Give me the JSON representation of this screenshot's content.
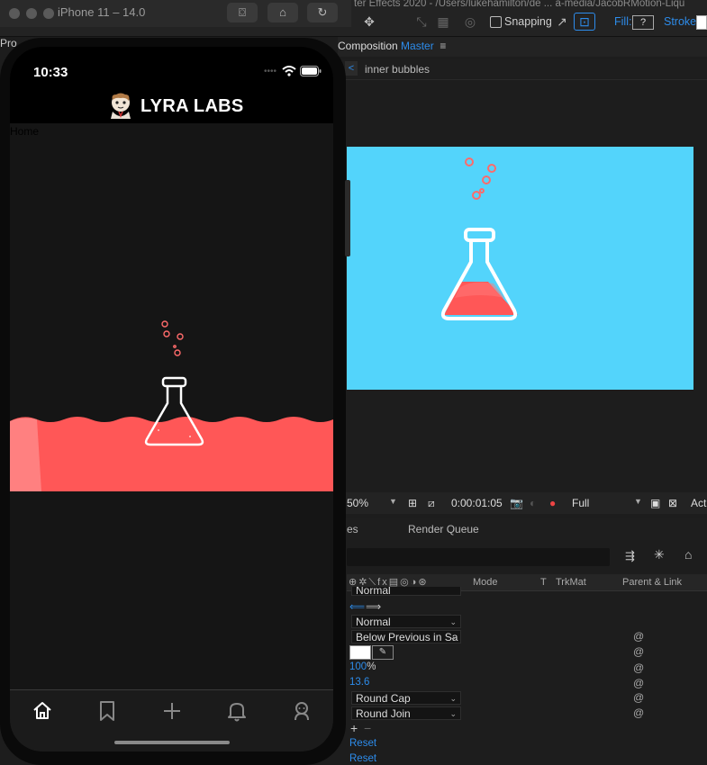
{
  "simulator": {
    "title": "iPhone 11 – 14.0"
  },
  "app": {
    "status_time": "10:33",
    "brand": "LYRA LABS",
    "page_label": "Home",
    "tabs": [
      "home-icon",
      "bookmark-icon",
      "plus-icon",
      "bell-icon",
      "profile-icon"
    ]
  },
  "ae": {
    "window_title": "ter Effects 2020 - /Users/lukehamilton/de ... a-media/JacobRMotion-Liqu",
    "snapping_label": "Snapping",
    "fill_label": "Fill:",
    "fill_value": "?",
    "stroke_label": "Stroke:",
    "left_panel_label": "Pro",
    "composition_label": "Composition",
    "composition_name": "Master",
    "breadcrumb": "inner bubbles",
    "zoom": "50%",
    "timecode": "0:00:01:05",
    "resolution": "Full",
    "active_label": "Acti",
    "tab_partial": "es",
    "tab_render_queue": "Render Queue",
    "col_mode": "Mode",
    "col_t": "T",
    "col_trkmat": "TrkMat",
    "col_parent": "Parent & Link",
    "dd_partial": "Normal",
    "dd_blend": "Normal",
    "dd_composite": "Below Previous in Sa",
    "opacity_value": "100",
    "opacity_unit": "%",
    "stroke_width": "13.6",
    "dd_cap": "Round Cap",
    "dd_join": "Round Join",
    "reset1": "Reset",
    "reset2": "Reset"
  },
  "colors": {
    "viewer_bg": "#53d4fb",
    "liquid": "#ff5757",
    "liquid_light": "#ff8080",
    "accent_blue": "#2d8ceb"
  }
}
